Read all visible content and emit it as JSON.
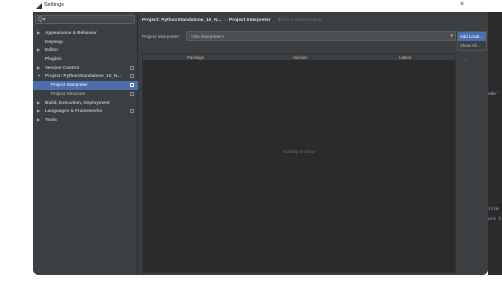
{
  "titlebar": {
    "title": "Settings",
    "close": "×"
  },
  "sidebar": {
    "search_icon": "Q▾",
    "items": [
      {
        "label": "Appearance & Behavior",
        "arrow": "▶"
      },
      {
        "label": "Keymap",
        "arrow": ""
      },
      {
        "label": "Editor",
        "arrow": "▶"
      },
      {
        "label": "Plugins",
        "arrow": ""
      },
      {
        "label": "Version Control",
        "arrow": "▶"
      },
      {
        "label": "Project: PythonStandalone_10_N...",
        "arrow": "▼"
      },
      {
        "label": "Project Interpreter",
        "arrow": ""
      },
      {
        "label": "Project Structure",
        "arrow": ""
      },
      {
        "label": "Build, Execution, Deployment",
        "arrow": "▶"
      },
      {
        "label": "Languages & Frameworks",
        "arrow": "▶"
      },
      {
        "label": "Tools",
        "arrow": "▶"
      }
    ]
  },
  "main": {
    "breadcrumb_project": "Project: PythonStandalone_10_N...",
    "breadcrumb_sep": "›",
    "breadcrumb_page": "Project Interpreter",
    "breadcrumb_note_icon": "⧉",
    "breadcrumb_note": "For current project",
    "interpreter_label": "Project Interpreter:",
    "interpreter_value": "<No interpreter>",
    "interpreter_chevron": "▾",
    "gear_menu": [
      "Add Local...",
      "Show All..."
    ],
    "table": {
      "columns": [
        "Package",
        "Version",
        "Latest"
      ],
      "empty_text": "Nothing to show"
    },
    "side_tools": [
      "+",
      "−",
      "↑"
    ]
  },
  "edge_text": [
    "ode'",
    "rile",
    "ure t"
  ]
}
